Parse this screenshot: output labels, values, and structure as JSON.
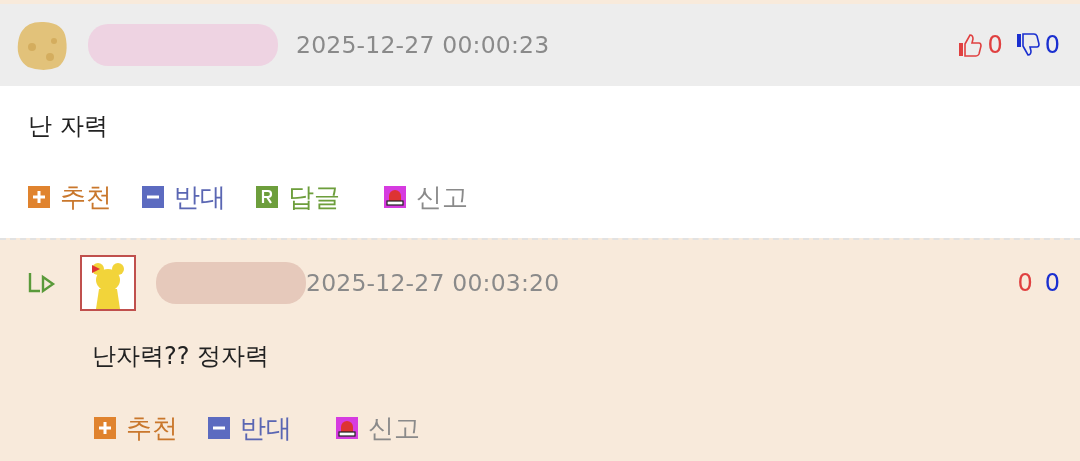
{
  "comments": [
    {
      "kind": "top",
      "timestamp": "2025-12-27 00:00:23",
      "likes": "0",
      "dislikes": "0",
      "body": "난 자력",
      "actions": [
        {
          "kind": "recommend",
          "label": "추천"
        },
        {
          "kind": "oppose",
          "label": "반대"
        },
        {
          "kind": "reply",
          "label": "답글"
        },
        {
          "kind": "report",
          "label": "신고"
        }
      ]
    },
    {
      "kind": "reply",
      "timestamp": "2025-12-27 00:03:20",
      "likes": "0",
      "dislikes": "0",
      "body": "난자력?? 정자력",
      "actions": [
        {
          "kind": "recommend",
          "label": "추천"
        },
        {
          "kind": "oppose",
          "label": "반대"
        },
        {
          "kind": "report",
          "label": "신고"
        }
      ]
    }
  ]
}
